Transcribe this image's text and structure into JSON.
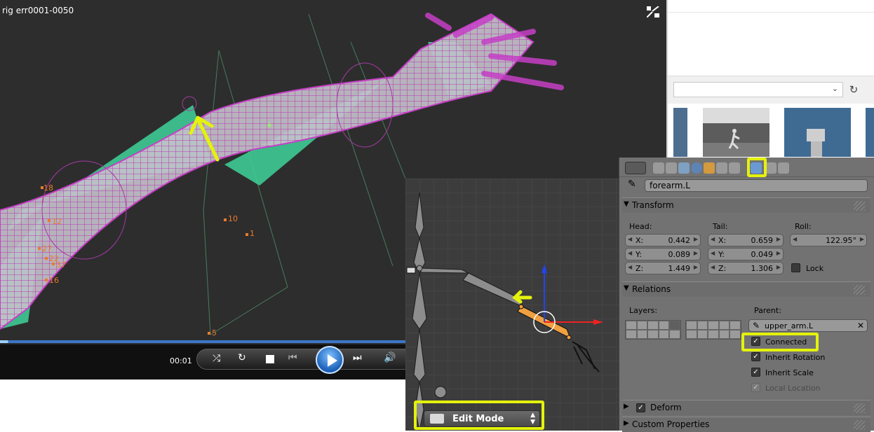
{
  "video_player": {
    "title": "rig err0001-0050",
    "time": "00:01",
    "progress": 0.02,
    "scene_labels": [
      "16",
      "22",
      "27",
      "37",
      "10",
      "1",
      "5",
      "12",
      "18"
    ]
  },
  "viewport": {
    "mode": "Edit Mode"
  },
  "properties": {
    "bone_name": "forearm.L",
    "transform": {
      "label": "Transform",
      "head_label": "Head:",
      "tail_label": "Tail:",
      "roll_label": "Roll:",
      "head": [
        {
          "axis": "X:",
          "value": "0.442"
        },
        {
          "axis": "Y:",
          "value": "0.089"
        },
        {
          "axis": "Z:",
          "value": "1.449"
        }
      ],
      "tail": [
        {
          "axis": "X:",
          "value": "0.659"
        },
        {
          "axis": "Y:",
          "value": "0.049"
        },
        {
          "axis": "Z:",
          "value": "1.306"
        }
      ],
      "roll": "122.95°",
      "lock_label": "Lock"
    },
    "relations": {
      "label": "Relations",
      "layers_label": "Layers:",
      "parent_label": "Parent:",
      "parent": "upper_arm.L",
      "connected": "Connected",
      "inherit_rotation": "Inherit Rotation",
      "inherit_scale": "Inherit Scale",
      "local_location": "Local Location"
    },
    "deform_label": "Deform",
    "custom_properties_label": "Custom Properties"
  },
  "colors": {
    "highlight": "#e4f20d",
    "mesh_wire": "#c63fc6",
    "bone_shape": "#3fd39a",
    "selected_bone": "#f0a040"
  }
}
